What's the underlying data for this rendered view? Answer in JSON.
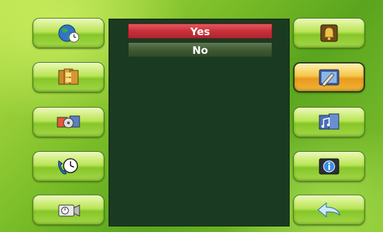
{
  "dialog": {
    "options": [
      {
        "label": "Yes",
        "state": "selected"
      },
      {
        "label": "No",
        "state": "normal"
      }
    ]
  },
  "left_menu": [
    {
      "icon": "globe-clock-icon"
    },
    {
      "icon": "film-strip-icon"
    },
    {
      "icon": "media-gallery-icon"
    },
    {
      "icon": "phone-clock-icon"
    },
    {
      "icon": "camera-icon"
    }
  ],
  "right_menu": [
    {
      "icon": "bell-icon"
    },
    {
      "icon": "display-settings-icon",
      "active": true
    },
    {
      "icon": "music-media-icon"
    },
    {
      "icon": "info-icon"
    },
    {
      "icon": "back-arrow-icon"
    }
  ],
  "colors": {
    "background": "#7fc02a",
    "button_normal": "#a4d847",
    "button_active": "#f3b43a",
    "panel": "#1b3a22",
    "option_selected": "#c9303a",
    "option_normal": "#3f5a34"
  }
}
